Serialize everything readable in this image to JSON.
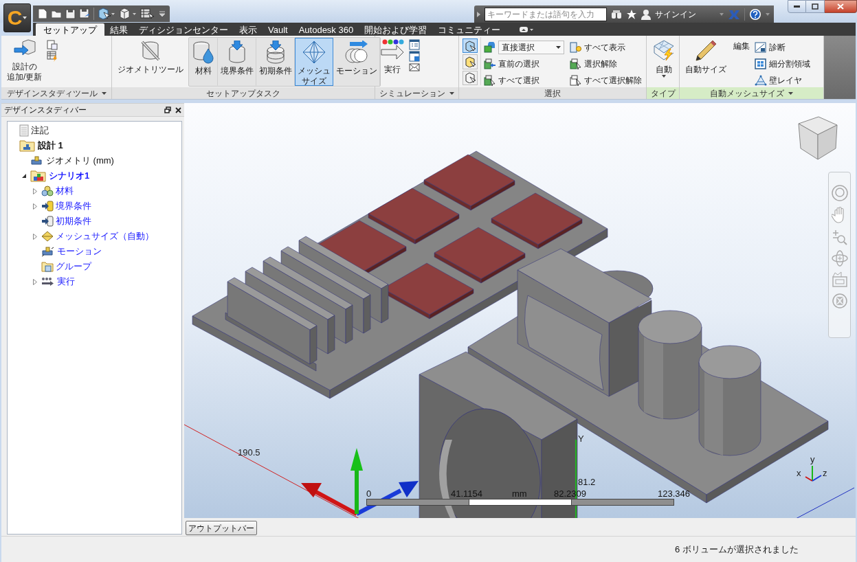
{
  "title_bar": {
    "app_button": "C",
    "search": {
      "placeholder": "キーワードまたは語句を入力"
    },
    "sign_in": "サインイン"
  },
  "tabs": [
    {
      "label": "セットアップ",
      "selected": true
    },
    {
      "label": "結果",
      "selected": false
    },
    {
      "label": "ディシジョンセンター",
      "selected": false
    },
    {
      "label": "表示",
      "selected": false
    },
    {
      "label": "Vault",
      "selected": false
    },
    {
      "label": "Autodesk 360",
      "selected": false
    },
    {
      "label": "開始および学習",
      "selected": false
    },
    {
      "label": "コミュニティー",
      "selected": false
    }
  ],
  "ribbon": {
    "panels": [
      {
        "title": "デザインスタディツール",
        "menu": true,
        "color": "#e2e2e2",
        "buttons": [
          {
            "kind": "large",
            "lines": [
              "設計の",
              "追加/更新"
            ]
          },
          {
            "kind": "icon"
          },
          {
            "kind": "icon"
          }
        ]
      },
      {
        "title": "セットアップタスク",
        "menu": false,
        "color": "#e2e2e2",
        "buttons": [
          {
            "kind": "large",
            "lines": [
              "ジオメトリツール"
            ]
          },
          {
            "kind": "toggle",
            "lines": [
              "材料"
            ],
            "selected": false
          },
          {
            "kind": "toggle",
            "lines": [
              "境界条件"
            ],
            "selected": false
          },
          {
            "kind": "toggle",
            "lines": [
              "初期条件"
            ],
            "selected": false
          },
          {
            "kind": "toggle",
            "lines": [
              "メッシュ",
              "サイズ"
            ],
            "selected": true
          },
          {
            "kind": "toggle",
            "lines": [
              "モーション"
            ],
            "selected": false
          }
        ]
      },
      {
        "title": "シミュレーション",
        "menu": true,
        "color": "#e2e2e2",
        "buttons": [
          {
            "kind": "large",
            "lines": [
              "実行"
            ]
          },
          {
            "kind": "icon"
          },
          {
            "kind": "icon"
          },
          {
            "kind": "icon"
          }
        ]
      },
      {
        "title": "選択",
        "menu": false,
        "color": "#e2e2e2",
        "buttons": [
          {
            "kind": "mode",
            "selected": true
          },
          {
            "kind": "mode",
            "selected": false
          },
          {
            "kind": "mode",
            "selected": false
          },
          {
            "kind": "dropdown",
            "label": "直接選択"
          },
          {
            "kind": "small",
            "label": "直前の選択"
          },
          {
            "kind": "small",
            "label": "すべて選択"
          },
          {
            "kind": "small",
            "label": "すべて表示"
          },
          {
            "kind": "small",
            "label": "選択解除"
          },
          {
            "kind": "small",
            "label": "すべて選択解除"
          }
        ]
      },
      {
        "title": "タイプ",
        "menu": false,
        "color": "#d6ecc6",
        "buttons": [
          {
            "kind": "split",
            "lines": [
              "自動"
            ]
          }
        ]
      },
      {
        "title": "自動メッシュサイズ",
        "menu": true,
        "color": "#d6ecc6",
        "buttons": [
          {
            "kind": "large",
            "lines": [
              "自動サイズ"
            ]
          },
          {
            "kind": "large",
            "lines": [
              "編集"
            ]
          },
          {
            "kind": "small",
            "label": "診断"
          },
          {
            "kind": "small",
            "label": "細分割領域"
          },
          {
            "kind": "small",
            "label": "壁レイヤ"
          }
        ]
      }
    ]
  },
  "design_study_bar": {
    "title": "デザインスタディバー",
    "tree": [
      {
        "label": "注記",
        "kind": "plain",
        "bold": false,
        "expandable": false
      },
      {
        "label": "設計 1",
        "kind": "plain",
        "bold": true,
        "expandable": false,
        "children": [
          {
            "label": "ジオメトリ (mm)",
            "kind": "plain",
            "bold": false,
            "expandable": false
          },
          {
            "label": "シナリオ1",
            "kind": "link",
            "bold": true,
            "expandable": true,
            "expanded": true,
            "children": [
              {
                "label": "材料",
                "kind": "link",
                "bold": false,
                "expandable": true,
                "expanded": false
              },
              {
                "label": "境界条件",
                "kind": "link",
                "bold": false,
                "expandable": true,
                "expanded": false
              },
              {
                "label": "初期条件",
                "kind": "link",
                "bold": false,
                "expandable": false
              },
              {
                "label": "メッシュサイズ（自動）",
                "kind": "link",
                "bold": false,
                "expandable": true,
                "expanded": false
              },
              {
                "label": "モーション",
                "kind": "link",
                "bold": false,
                "expandable": false
              },
              {
                "label": "グループ",
                "kind": "link",
                "bold": false,
                "expandable": false
              },
              {
                "label": "実行",
                "kind": "link",
                "bold": false,
                "expandable": true,
                "expanded": false
              }
            ]
          }
        ]
      }
    ]
  },
  "viewport": {
    "dimension_label": "190.5",
    "y_axis_label": "Y",
    "y_reading": "81.2",
    "scale_bar": {
      "unit": "mm",
      "ticks": [
        "0",
        "41.1154",
        "82.2309",
        "123.346"
      ]
    },
    "triad_labels": [
      "x",
      "y",
      "z"
    ]
  },
  "output_bar_button": "アウトプットバー",
  "status_bar": {
    "message": "6 ボリュームが選択されました"
  }
}
